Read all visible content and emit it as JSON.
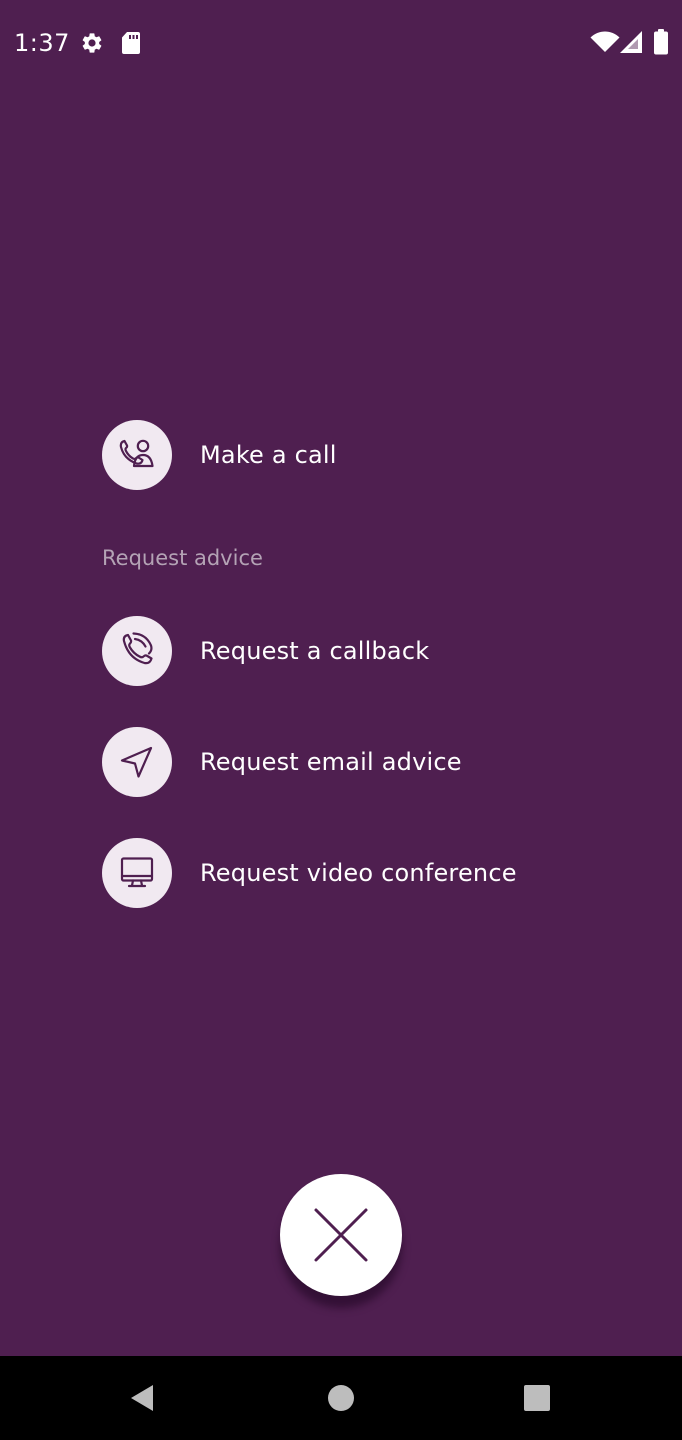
{
  "status_bar": {
    "time": "1:37",
    "icons": [
      "settings-icon",
      "sd-card-icon",
      "wifi-icon",
      "cell-signal-icon",
      "battery-icon"
    ]
  },
  "actions": {
    "make_call": {
      "label": "Make a call",
      "icon": "phone-person-icon"
    },
    "section_heading": "Request advice",
    "items": [
      {
        "label": "Request a callback",
        "icon": "phone-callback-icon"
      },
      {
        "label": "Request email advice",
        "icon": "send-icon"
      },
      {
        "label": "Request video conference",
        "icon": "monitor-icon"
      }
    ]
  },
  "close_button": {
    "icon": "close-icon"
  },
  "nav_bar": {
    "buttons": [
      "back-icon",
      "home-icon",
      "recents-icon"
    ]
  },
  "colors": {
    "background": "#4F1F50",
    "circle": "#F1E9F1",
    "icon_stroke": "#4F1F50",
    "section_heading": "#B4A3B5",
    "nav_bar": "#000000",
    "nav_icon": "#BDBDBD"
  }
}
